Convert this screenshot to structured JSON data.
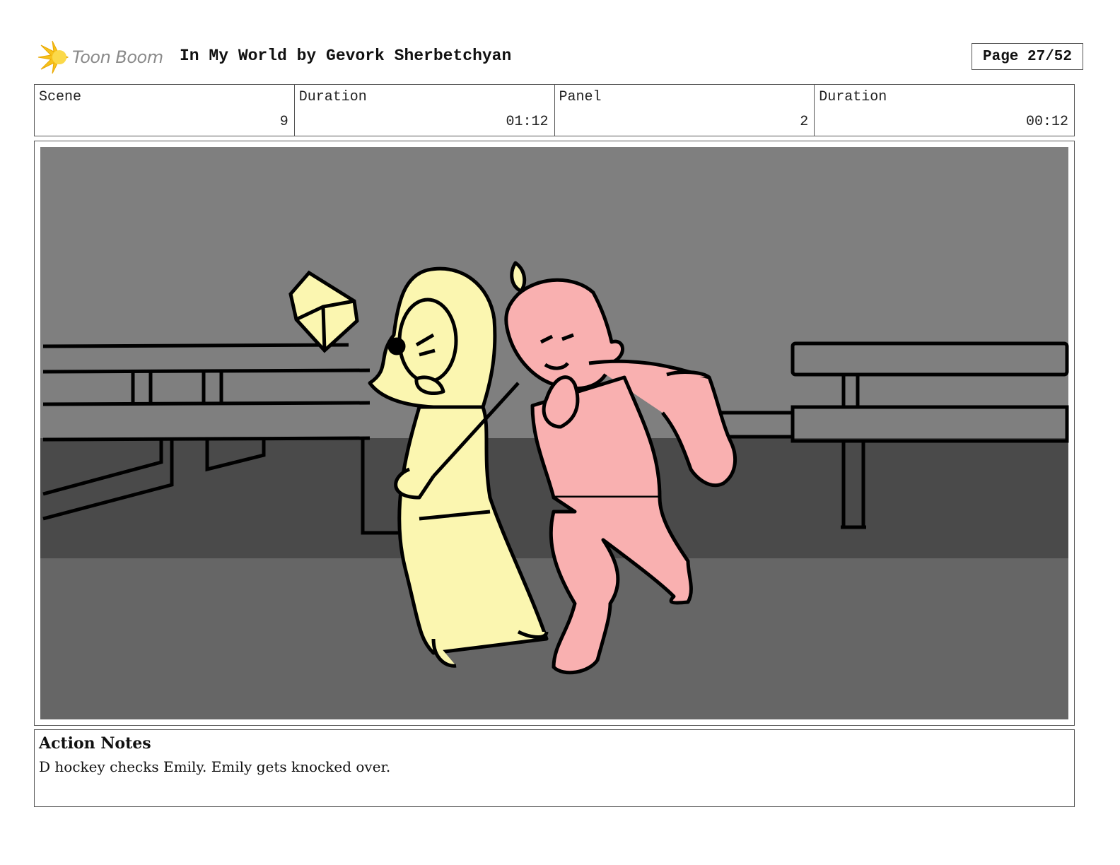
{
  "header": {
    "logo_text": "Toon Boom",
    "title": "In My World by Gevork Sherbetchyan",
    "page_label": "Page 27/52"
  },
  "info": {
    "scene_label": "Scene",
    "scene_value": "9",
    "scene_duration_label": "Duration",
    "scene_duration_value": "01:12",
    "panel_label": "Panel",
    "panel_value": "2",
    "panel_duration_label": "Duration",
    "panel_duration_value": "00:12"
  },
  "panel": {
    "image_icon": "storyboard-sketch",
    "colors": {
      "wall": "#7f7f7f",
      "floor_dark": "#4a4a4a",
      "floor": "#666666",
      "emily": "#fbf6b0",
      "d_hockey": "#f9b0b0"
    }
  },
  "notes": {
    "title": "Action Notes",
    "text": "D hockey checks Emily. Emily gets knocked over."
  }
}
